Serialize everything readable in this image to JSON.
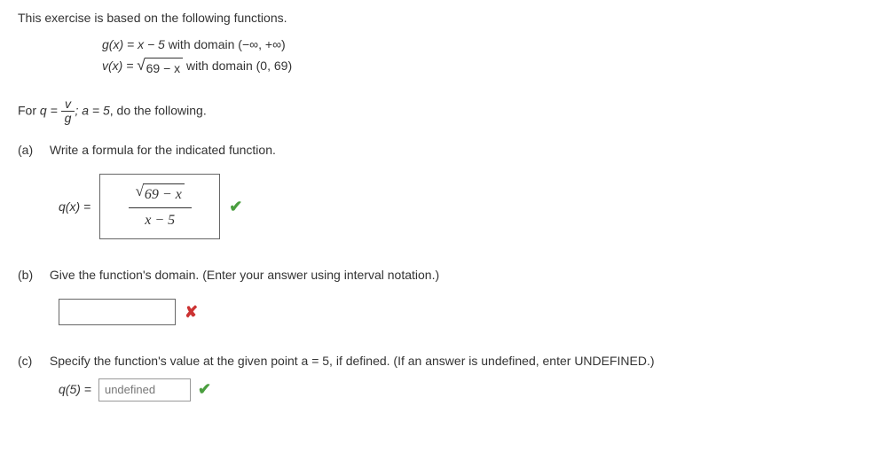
{
  "intro": "This exercise is based on the following functions.",
  "functions": {
    "g_left": "g(x) = x − 5",
    "g_domain": " with domain (−∞, +∞)",
    "v_left": "v(x) = ",
    "v_sqrt_body": "69 − x",
    "v_domain": " with domain (0, 69)"
  },
  "prompt": {
    "prefix": "For ",
    "q_eq": "q = ",
    "frac_num": "v",
    "frac_den": "g",
    "a_part": "; a = 5",
    "suffix": ", do the following."
  },
  "parts": {
    "a": {
      "label": "(a)",
      "text": "Write a formula for the indicated function.",
      "qx": "q(x) = ",
      "answer_num_sqrt": "69 − x",
      "answer_den": "x − 5",
      "correct": true
    },
    "b": {
      "label": "(b)",
      "text": "Give the function's domain. (Enter your answer using interval notation.)",
      "answer": "",
      "correct": false
    },
    "c": {
      "label": "(c)",
      "text": "Specify the function's value at the given point a = 5, if defined. (If an answer is undefined, enter UNDEFINED.)",
      "q5": "q(5) = ",
      "answer": "undefined",
      "correct": true
    }
  }
}
